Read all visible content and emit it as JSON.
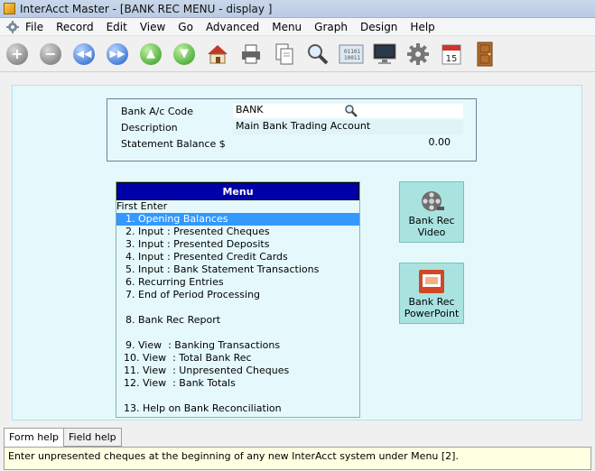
{
  "window": {
    "title": "InterAcct Master - [BANK REC MENU - display ]"
  },
  "menubar": {
    "items": [
      "File",
      "Record",
      "Edit",
      "View",
      "Go",
      "Advanced",
      "Menu",
      "Graph",
      "Design",
      "Help"
    ]
  },
  "toolbar": {
    "buttons": [
      "add-icon",
      "remove-icon",
      "previous-icon",
      "next-icon",
      "up-icon",
      "down-icon",
      "home-icon",
      "print-icon",
      "copy-document-icon",
      "search-icon",
      "binary-data-icon",
      "monitor-icon",
      "settings-gear-icon",
      "calendar-icon",
      "door-exit-icon"
    ],
    "calendar_day": "15"
  },
  "form": {
    "bank_code_label": "Bank A/c Code",
    "bank_code_value": "BANK",
    "description_label": "Description",
    "description_value": "Main Bank Trading Account",
    "statement_balance_label": "Statement Balance $",
    "statement_balance_value": "0.00"
  },
  "menu": {
    "header": "Menu",
    "lines": [
      {
        "text": "First Enter",
        "indent": false,
        "selected": false
      },
      {
        "text": "1. Opening Balances",
        "indent": true,
        "selected": true
      },
      {
        "text": "2. Input : Presented Cheques",
        "indent": true,
        "selected": false
      },
      {
        "text": "3. Input : Presented Deposits",
        "indent": true,
        "selected": false
      },
      {
        "text": "4. Input : Presented Credit Cards",
        "indent": true,
        "selected": false
      },
      {
        "text": "5. Input : Bank Statement Transactions",
        "indent": true,
        "selected": false
      },
      {
        "text": "6. Recurring Entries",
        "indent": true,
        "selected": false
      },
      {
        "text": "7. End of Period Processing",
        "indent": true,
        "selected": false
      },
      {
        "text": "",
        "indent": true,
        "selected": false
      },
      {
        "text": "8. Bank Rec Report",
        "indent": true,
        "selected": false
      },
      {
        "text": "",
        "indent": true,
        "selected": false
      },
      {
        "text": "9. View  : Banking Transactions",
        "indent": true,
        "selected": false
      },
      {
        "text": "10. View  : Total Bank Rec",
        "indent": false,
        "selected": false,
        "pad": 8
      },
      {
        "text": "11. View  : Unpresented Cheques",
        "indent": false,
        "selected": false,
        "pad": 8
      },
      {
        "text": "12. View  : Bank Totals",
        "indent": false,
        "selected": false,
        "pad": 8
      },
      {
        "text": "",
        "indent": true,
        "selected": false
      },
      {
        "text": "13. Help on Bank Reconciliation",
        "indent": false,
        "selected": false,
        "pad": 8
      }
    ]
  },
  "side_buttons": {
    "video": {
      "line1": "Bank Rec",
      "line2": "Video"
    },
    "powerpoint": {
      "line1": "Bank Rec",
      "line2": "PowerPoint"
    }
  },
  "help": {
    "tabs": [
      "Form help",
      "Field help"
    ],
    "active_tab": "Form help",
    "text": "Enter unpresented cheques at the beginning of any new InterAcct system under Menu [2]."
  },
  "colors": {
    "menu_header_bg": "#0000a8",
    "selected_bg": "#3399ff",
    "panel_bg": "#e5f9fc",
    "side_button_bg": "#a9e3e0",
    "help_bg": "#ffffe1"
  }
}
